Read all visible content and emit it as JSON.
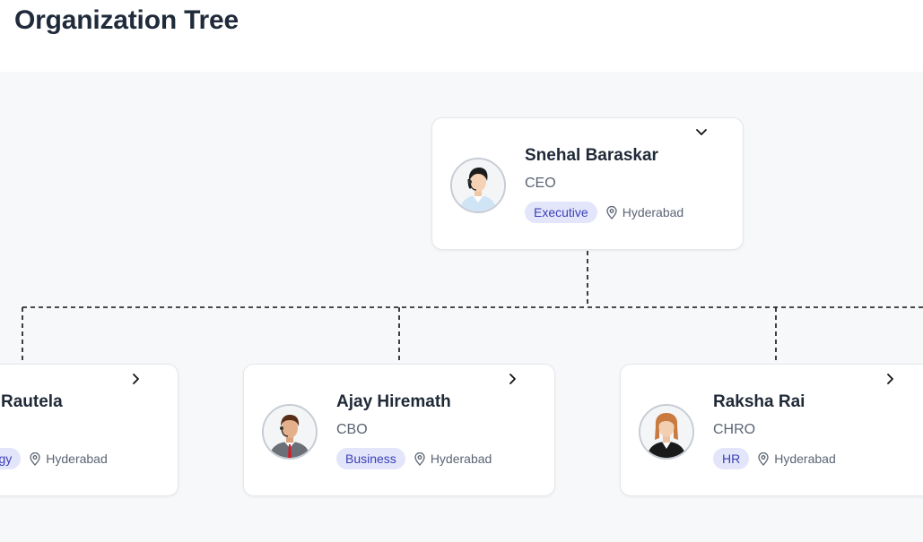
{
  "page": {
    "title": "Organization Tree"
  },
  "tree": {
    "root": {
      "name": "Snehal Baraskar",
      "role": "CEO",
      "department": "Executive",
      "location": "Hyderabad",
      "avatar": "female-headset-avatar",
      "toggle_icon": "chevron-down-icon"
    },
    "children": [
      {
        "name": "Rautela",
        "role": "",
        "department": "nology",
        "location": "Hyderabad",
        "toggle_icon": "chevron-right-icon"
      },
      {
        "name": "Ajay Hiremath",
        "role": "CBO",
        "department": "Business",
        "location": "Hyderabad",
        "avatar": "male-headset-avatar",
        "toggle_icon": "chevron-right-icon"
      },
      {
        "name": "Raksha Rai",
        "role": "CHRO",
        "department": "HR",
        "location": "Hyderabad",
        "avatar": "female-suit-avatar",
        "toggle_icon": "chevron-right-icon"
      }
    ]
  },
  "colors": {
    "badge_bg": "#e3e6fb",
    "badge_text": "#3b3fb6",
    "connector": "#111111",
    "canvas_bg": "#f7f8fa"
  }
}
